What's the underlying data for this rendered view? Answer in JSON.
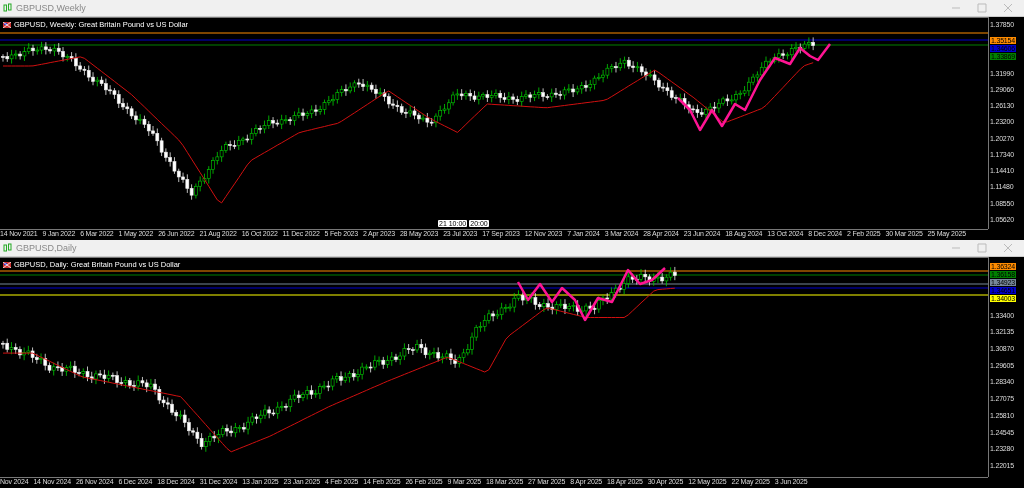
{
  "windows": [
    {
      "title": "GBPUSD,Weekly",
      "chart_label": "GBPUSD, Weekly:  Great Britain Pound vs US Dollar",
      "price_ticks": [
        "1.37850",
        "1.31990",
        "1.29060",
        "1.26130",
        "1.23200",
        "1.20270",
        "1.17340",
        "1.14410",
        "1.11480",
        "1.08550",
        "1.05620"
      ],
      "price_tags": [
        {
          "text": "1.35154",
          "color": "#ff8c00"
        },
        {
          "text": "1.34606",
          "color": "#0000cc"
        },
        {
          "text": "1.33869",
          "color": "#008000"
        }
      ],
      "time_tags": [
        "21 10:00",
        "20:00"
      ],
      "date_ticks": [
        "14 Nov 2021",
        "9 Jan 2022",
        "6 Mar 2022",
        "1 May 2022",
        "26 Jun 2022",
        "21 Aug 2022",
        "16 Oct 2022",
        "11 Dec 2022",
        "5 Feb 2023",
        "2 Apr 2023",
        "28 May 2023",
        "23 Jul 2023",
        "17 Sep 2023",
        "12 Nov 2023",
        "7 Jan 2024",
        "3 Mar 2024",
        "28 Apr 2024",
        "23 Jun 2024",
        "18 Aug 2024",
        "13 Oct 2024",
        "8 Dec 2024",
        "2 Feb 2025",
        "30 Mar 2025",
        "25 May 2025"
      ]
    },
    {
      "title": "GBPUSD,Daily",
      "chart_label": "GBPUSD, Daily:  Great Britain Pound vs US Dollar",
      "price_ticks": [
        "1.33400",
        "1.32135",
        "1.30870",
        "1.29605",
        "1.28340",
        "1.27075",
        "1.25810",
        "1.24545",
        "1.23280",
        "1.22015"
      ],
      "price_tags": [
        {
          "text": "1.36324",
          "color": "#ff8c00"
        },
        {
          "text": "1.36158",
          "color": "#008000"
        },
        {
          "text": "1.34923",
          "color": "#778899"
        },
        {
          "text": "1.34651",
          "color": "#0000cc"
        },
        {
          "text": "1.34003",
          "color": "#ffff00"
        }
      ],
      "date_ticks": [
        "Nov 2024",
        "14 Nov 2024",
        "26 Nov 2024",
        "6 Dec 2024",
        "18 Dec 2024",
        "31 Dec 2024",
        "13 Jan 2025",
        "23 Jan 2025",
        "4 Feb 2025",
        "14 Feb 2025",
        "26 Feb 2025",
        "9 Mar 2025",
        "18 Mar 2025",
        "27 Mar 2025",
        "8 Apr 2025",
        "18 Apr 2025",
        "30 Apr 2025",
        "12 May 2025",
        "22 May 2025",
        "3 Jun 2025"
      ]
    }
  ]
}
